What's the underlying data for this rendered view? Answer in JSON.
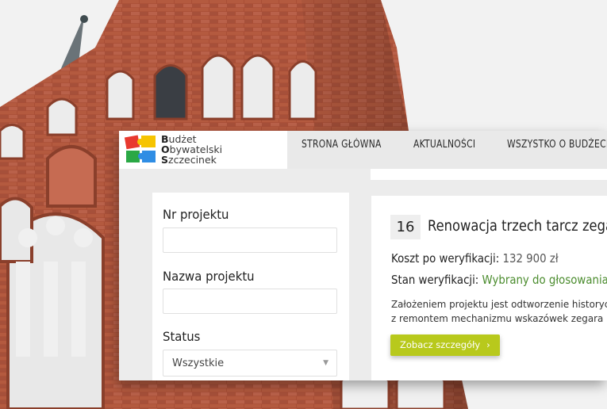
{
  "logo": {
    "line1_initial": "B",
    "line1_rest": "udżet",
    "line2_initial": "O",
    "line2_rest": "bywatelski",
    "line3_initial": "S",
    "line3_rest": "zczecinek",
    "colors": [
      "#e8392f",
      "#f6c400",
      "#2aa845",
      "#2f8de4"
    ]
  },
  "nav": {
    "items": [
      "STRONA GŁÓWNA",
      "AKTUALNOŚCI",
      "WSZYSTKO O BUDŻECIE"
    ]
  },
  "filters": {
    "project_number_label": "Nr projektu",
    "project_number_value": "",
    "project_name_label": "Nazwa projektu",
    "project_name_value": "",
    "status_label": "Status",
    "status_value": "Wszystkie",
    "status_chevron_icon": "chevron-down-icon"
  },
  "project": {
    "number": "16",
    "title": "Renowacja trzech tarcz zegara",
    "cost_label": "Koszt po weryfikacji:",
    "cost_value": "132 900 zł",
    "status_label": "Stan weryfikacji:",
    "status_value": "Wybrany do głosowania",
    "description_line1": "Założeniem projektu jest odtworzenie historyczny",
    "description_line2": "z remontem mechanizmu wskazówek zegara",
    "details_button": "Zobacz szczegóły",
    "details_arrow": "›",
    "accent_color": "#b8c91c",
    "status_color": "#4b8c2e"
  }
}
